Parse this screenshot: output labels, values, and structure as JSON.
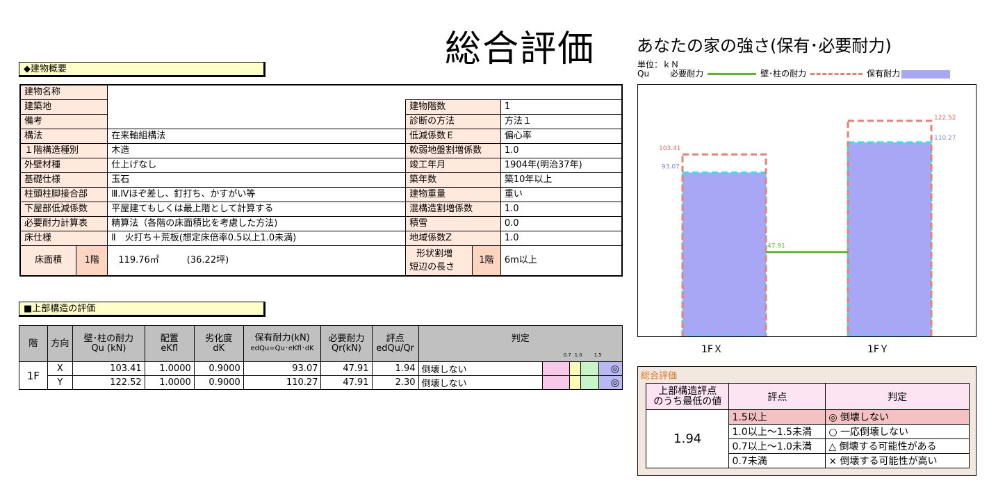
{
  "main_title": "総合評価",
  "building": {
    "section_header": "◆建物概要",
    "rows": [
      {
        "label": "建物名称",
        "value": "",
        "label2": "",
        "value2": ""
      },
      {
        "label": "建築地",
        "value": "",
        "label2": "建物階数",
        "value2": "1"
      },
      {
        "label": "備考",
        "value": "",
        "label2": "診断の方法",
        "value2": "方法１"
      },
      {
        "label": "構法",
        "value": "在来軸組構法",
        "label2": "低減係数Ｅ",
        "value2": "偏心率"
      },
      {
        "label": "１階構造種別",
        "value": "木造",
        "label2": "軟弱地盤割増係数",
        "value2": "1.0"
      },
      {
        "label": "外壁材種",
        "value": "仕上げなし",
        "label2": "竣工年月",
        "value2": "1904年(明治37年)"
      },
      {
        "label": "基礎仕様",
        "value": "玉石",
        "label2": "築年数",
        "value2": "築10年以上"
      },
      {
        "label": "柱頭柱脚接合部",
        "value": "Ⅲ.Ⅳほぞ差し、釘打ち、かすがい等",
        "label2": "建物重量",
        "value2": "重い"
      },
      {
        "label": "下屋部低減係数",
        "value": "平屋建てもしくは最上階として計算する",
        "label2": "混構造割増係数",
        "value2": "1.0"
      },
      {
        "label": "必要耐力計算表",
        "value": "精算法（各階の床面積比を考慮した方法)",
        "label2": "積雪",
        "value2": "0.0"
      },
      {
        "label": "床仕様",
        "value": "Ⅱ　火打ち＋荒板(想定床倍率0.5以上1.0未満)",
        "label2": "地域係数Z",
        "value2": "1.0"
      }
    ],
    "floor_area": {
      "label": "床面積",
      "floor": "1階",
      "area": "119.76㎡",
      "tsubo": "(36.22坪)"
    },
    "shape": {
      "label1": "形状割増",
      "label2": "短辺の長さ",
      "floor": "1階",
      "value": "6m以上"
    }
  },
  "structure": {
    "section_header": "■上部構造の評価",
    "headers": {
      "floor": "階",
      "dir": "方向",
      "qu1": "壁･柱の耐力",
      "qu2": "Qu (kN)",
      "ek1": "配置",
      "ek2": "eKfl",
      "dk1": "劣化度",
      "dk2": "dK",
      "hold1": "保有耐力(kN)",
      "hold2": "edQu=Qu･eKfl･dK",
      "req1": "必要耐力",
      "req2": "Qr(kN)",
      "score1": "評点",
      "score2": "edQu/Qr",
      "judge": "判定",
      "scale": [
        "0.7",
        "1.0",
        "1.5"
      ]
    },
    "floor_label": "1F",
    "rows": [
      {
        "dir": "X",
        "qu": "103.41",
        "ekfl": "1.0000",
        "dk": "0.9000",
        "hold": "93.07",
        "req": "47.91",
        "score": "1.94",
        "judge": "倒壊しない",
        "mark": "◎"
      },
      {
        "dir": "Y",
        "qu": "122.52",
        "ekfl": "1.0000",
        "dk": "0.9000",
        "hold": "110.27",
        "req": "47.91",
        "score": "2.30",
        "judge": "倒壊しない",
        "mark": "◎"
      }
    ]
  },
  "chart_data": {
    "type": "bar",
    "title": "あなたの家の強さ(保有･必要耐力)",
    "unit_label": "単位：ｋＮ",
    "legend": {
      "qu": "Qu",
      "required": "必要耐力",
      "wall": "壁･柱の耐力",
      "hold": "保有耐力"
    },
    "categories": [
      "1FＸ",
      "1FＹ"
    ],
    "series": [
      {
        "name": "壁･柱の耐力",
        "values": [
          103.41,
          122.52
        ]
      },
      {
        "name": "保有耐力",
        "values": [
          93.07,
          110.27
        ]
      },
      {
        "name": "必要耐力",
        "values": [
          47.91,
          47.91
        ]
      }
    ],
    "labels": {
      "wall": [
        "103.41",
        "122.52"
      ],
      "hold": [
        "93.07",
        "110.27"
      ],
      "required": "47.91"
    },
    "ylim": [
      0,
      143
    ],
    "colors": {
      "hold": "#a7a7f5",
      "wall": "#e8807a",
      "hold_outline": "#33e0f0",
      "required": "#5cb82a"
    }
  },
  "summary": {
    "title": "総合評価",
    "col1": "上部構造評点\nのうち最低の値",
    "col2": "評点",
    "col3": "判定",
    "min_score": "1.94",
    "rows": [
      {
        "score": "1.5以上",
        "judge": "◎ 倒壊しない"
      },
      {
        "score": "1.0以上～1.5未満",
        "judge": "○ 一応倒壊しない"
      },
      {
        "score": "0.7以上～1.0未満",
        "judge": "△ 倒壊する可能性がある"
      },
      {
        "score": "0.7未満",
        "judge": "× 倒壊する可能性が高い"
      }
    ]
  }
}
